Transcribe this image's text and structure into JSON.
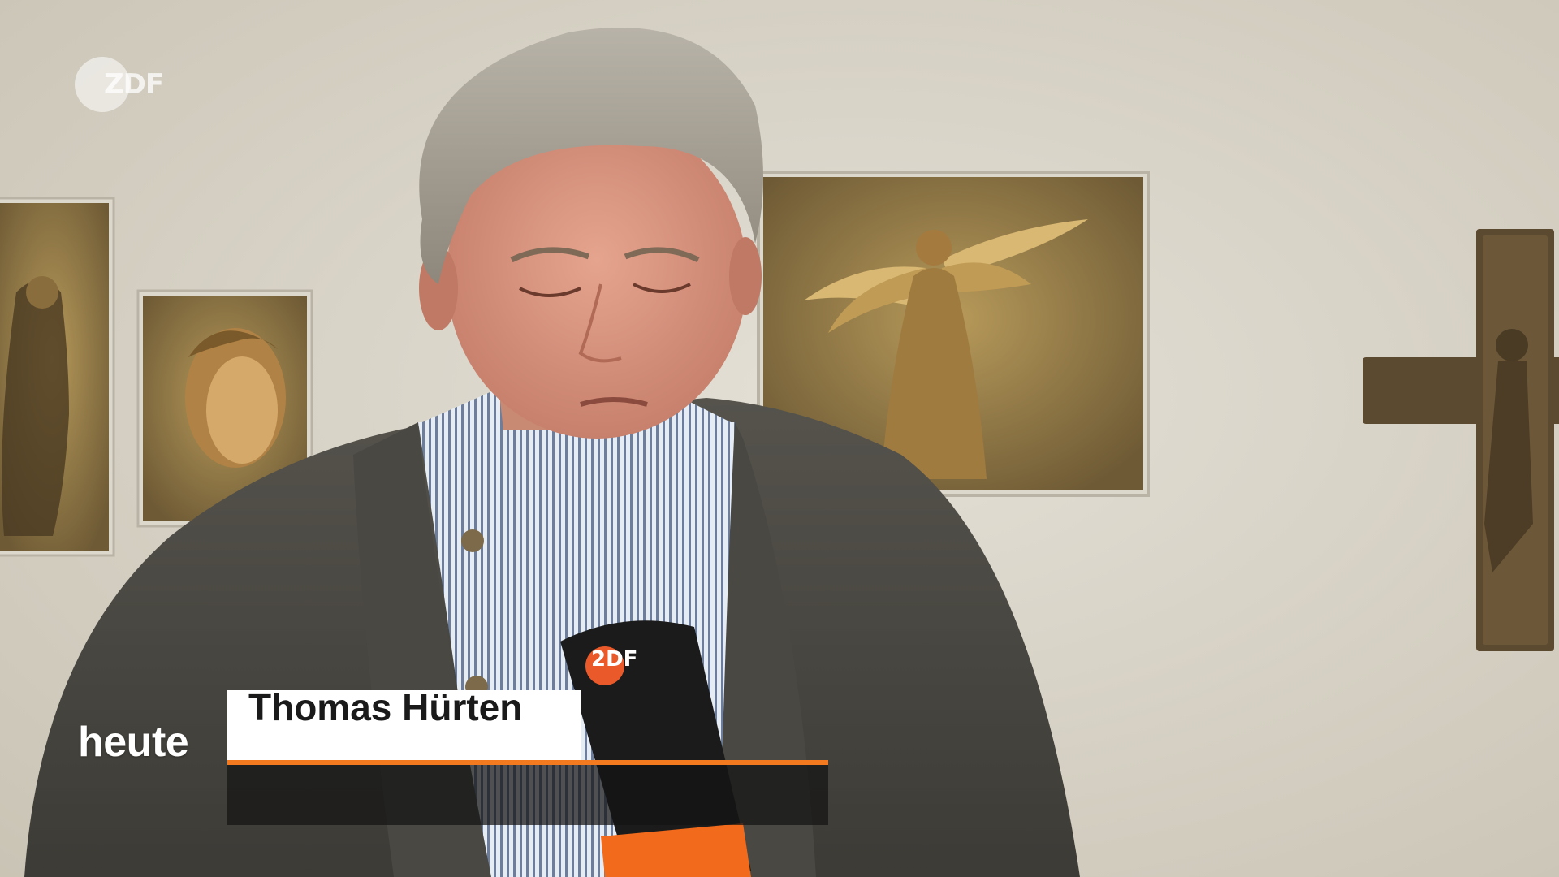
{
  "broadcast": {
    "channel_logo": "ZDF",
    "programme": "heute"
  },
  "lower_third": {
    "name": "Thomas Hürten",
    "caption": "",
    "accent_color": "#f47a20"
  },
  "microphone": {
    "brand": "ZDF",
    "color": "#f26a1b"
  },
  "icons": [
    "zdf-logo-icon",
    "cross-icon",
    "angel-picture",
    "microphone-icon"
  ]
}
